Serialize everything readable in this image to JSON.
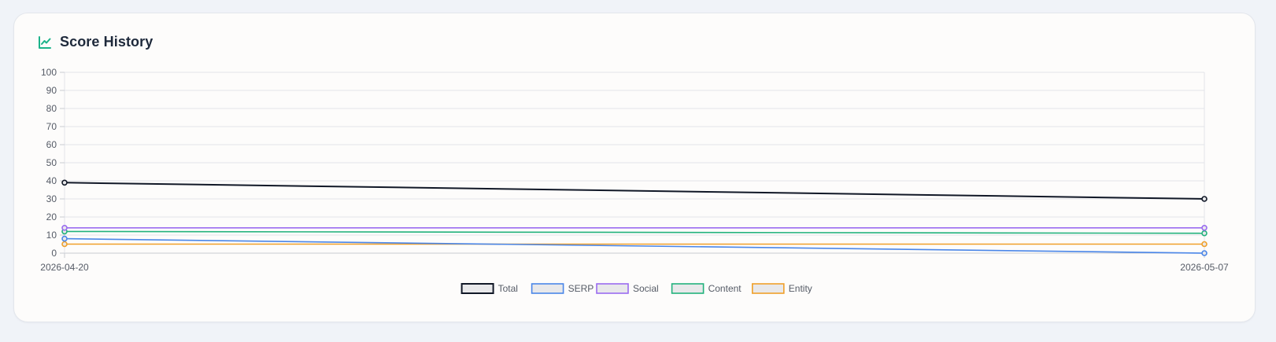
{
  "card": {
    "title": "Score History",
    "icon": "chart-line-icon",
    "accent": "#1bb38a"
  },
  "chart_data": {
    "type": "line",
    "x": [
      "2026-04-20",
      "2026-05-07"
    ],
    "ylim": [
      0,
      100
    ],
    "yticks": [
      0,
      10,
      20,
      30,
      40,
      50,
      60,
      70,
      80,
      90,
      100
    ],
    "grid": true,
    "legend": "bottom-center",
    "series": [
      {
        "name": "Total",
        "color": "#111827",
        "values": [
          39,
          30
        ]
      },
      {
        "name": "SERP",
        "color": "#4a86e8",
        "values": [
          8,
          0
        ]
      },
      {
        "name": "Social",
        "color": "#9b6cf0",
        "values": [
          14,
          14
        ]
      },
      {
        "name": "Content",
        "color": "#22b27c",
        "values": [
          12,
          11
        ]
      },
      {
        "name": "Entity",
        "color": "#f0a02a",
        "values": [
          5,
          5
        ]
      }
    ]
  }
}
